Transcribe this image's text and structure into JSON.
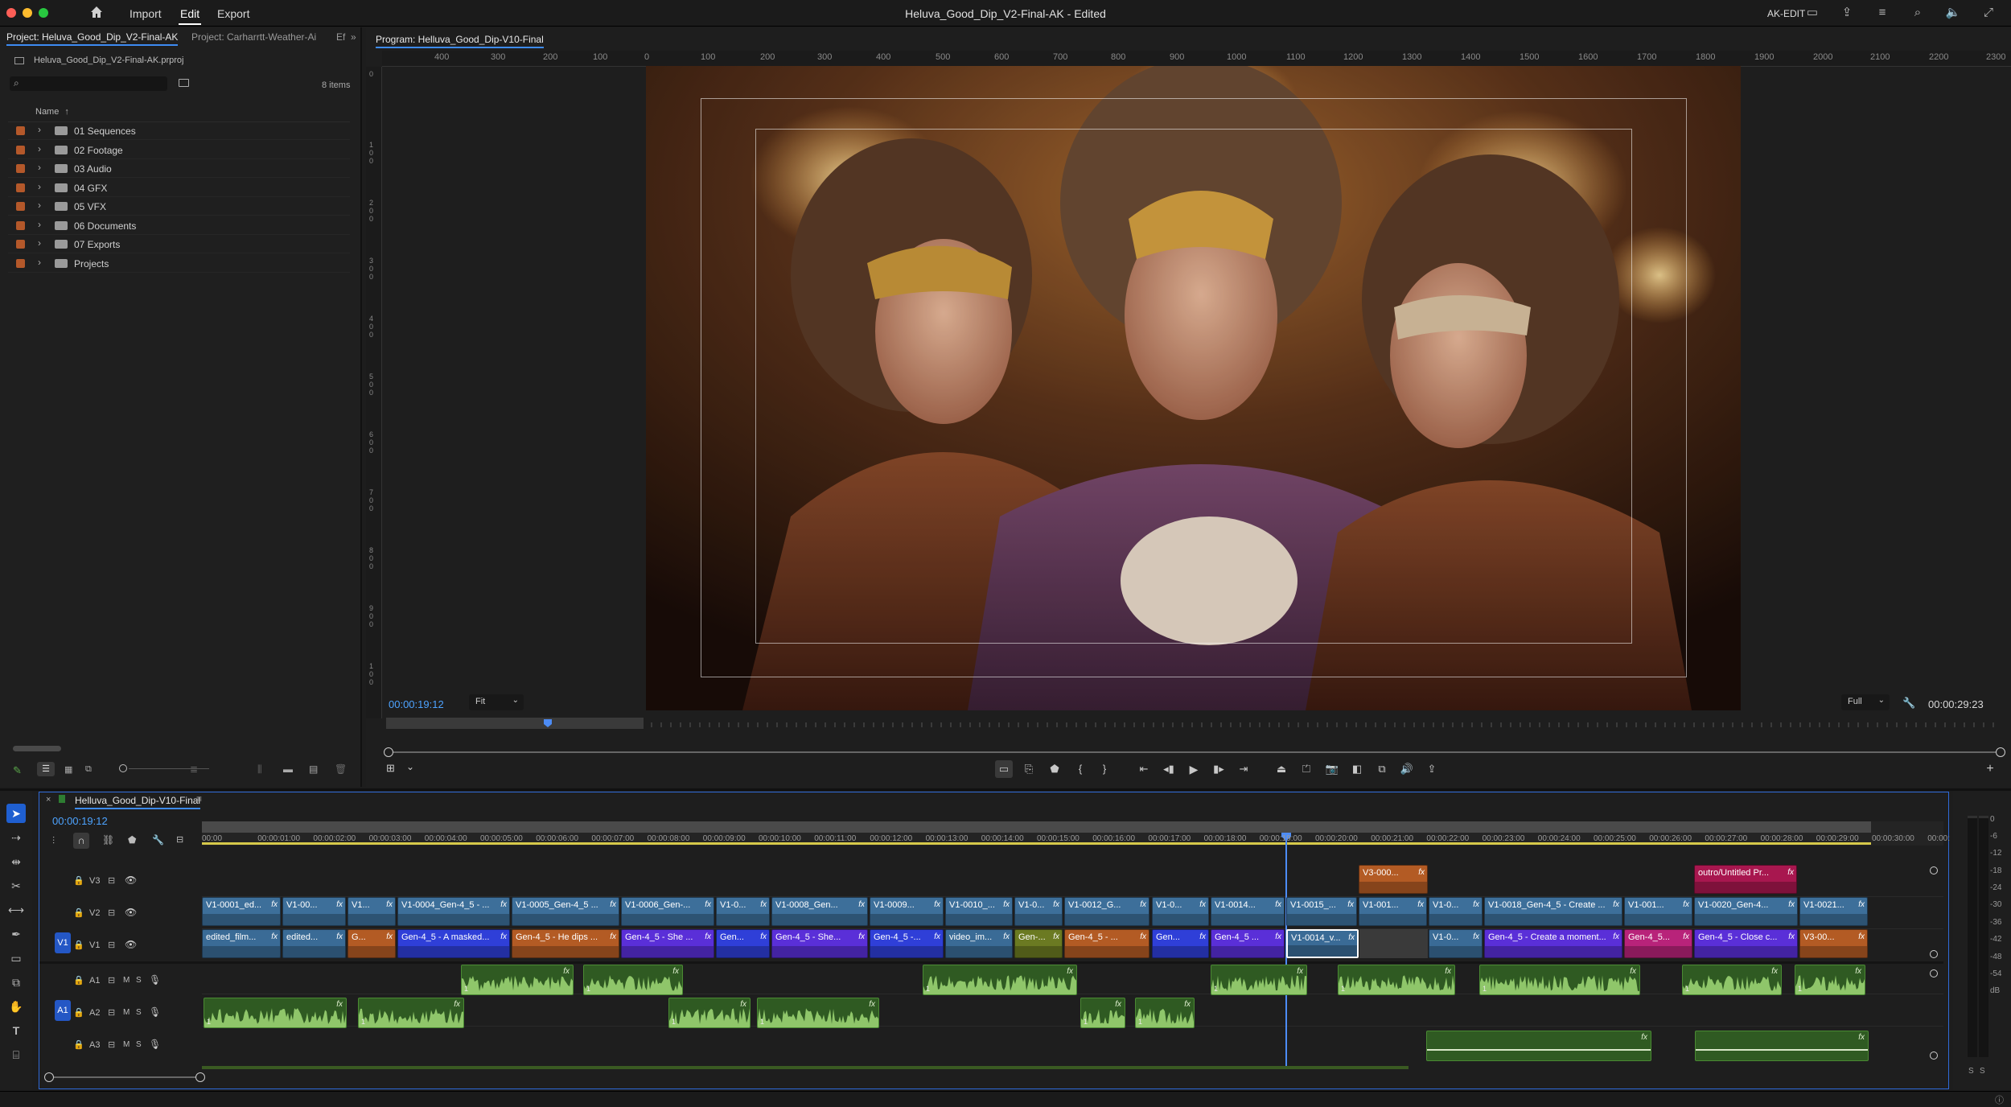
{
  "window": {
    "title": "Heluva_Good_Dip_V2-Final-AK - Edited",
    "workspace_user": "AK-EDIT"
  },
  "menu": {
    "import": "Import",
    "edit": "Edit",
    "export": "Export"
  },
  "project_panel": {
    "tab_active": "Project: Heluva_Good_Dip_V2-Final-AK",
    "tab_other": "Project: Carharrtt-Weather-Ai",
    "tab_effects": "Ef",
    "file_name": "Heluva_Good_Dip_V2-Final-AK.prproj",
    "item_count": "8 items",
    "column_name": "Name",
    "bins": [
      {
        "name": "01 Sequences"
      },
      {
        "name": "02 Footage"
      },
      {
        "name": "03 Audio"
      },
      {
        "name": "04 GFX"
      },
      {
        "name": "05 VFX"
      },
      {
        "name": "06 Documents"
      },
      {
        "name": "07 Exports"
      },
      {
        "name": "Projects"
      }
    ]
  },
  "program_monitor": {
    "tab": "Program: Helluva_Good_Dip-V10-Final",
    "ruler_labels": [
      "400",
      "300",
      "200",
      "100",
      "0",
      "100",
      "200",
      "300",
      "400",
      "500",
      "600",
      "700",
      "800",
      "900",
      "1000",
      "1100",
      "1200",
      "1300",
      "1400",
      "1500",
      "1600",
      "1700",
      "1800",
      "1900",
      "2000",
      "2100",
      "2200",
      "2300"
    ],
    "current_timecode": "00:00:19:12",
    "zoom": "Fit",
    "resolution": "Full",
    "duration": "00:00:29:23",
    "frame_description": "Three women in 18th-century ball gowns and masquerade masks with disgusted expressions in a candle-lit ballroom"
  },
  "timeline": {
    "sequence_name": "Helluva_Good_Dip-V10-Final",
    "playhead_timecode": "00:00:19:12",
    "ruler_labels": [
      "00:00",
      "00:00:01:00",
      "00:00:02:00",
      "00:00:03:00",
      "00:00:04:00",
      "00:00:05:00",
      "00:00:06:00",
      "00:00:07:00",
      "00:00:08:00",
      "00:00:09:00",
      "00:00:10:00",
      "00:00:11:00",
      "00:00:12:00",
      "00:00:13:00",
      "00:00:14:00",
      "00:00:15:00",
      "00:00:16:00",
      "00:00:17:00",
      "00:00:18:00",
      "00:00:19:00",
      "00:00:20:00",
      "00:00:21:00",
      "00:00:22:00",
      "00:00:23:00",
      "00:00:24:00",
      "00:00:25:00",
      "00:00:26:00",
      "00:00:27:00",
      "00:00:28:00",
      "00:00:29:00",
      "00:00:30:00",
      "00:00:"
    ],
    "tracks": {
      "v3": "V3",
      "v2": "V2",
      "v1": "V1",
      "a1": "A1",
      "a2": "A2",
      "a3": "A3",
      "src_v1": "V1",
      "src_a1": "A1",
      "m": "M",
      "s": "S"
    },
    "v3_clips": [
      {
        "label": "V3-000...",
        "color": "#b35b24"
      },
      {
        "label": "outro/Untitled Pr...",
        "color": "#a8174f"
      }
    ],
    "v2_clips": [
      {
        "label": "V1-0001_ed..."
      },
      {
        "label": "V1-00..."
      },
      {
        "label": "V1..."
      },
      {
        "label": "V1-0004_Gen-4_5 - ..."
      },
      {
        "label": "V1-0005_Gen-4_5 ..."
      },
      {
        "label": "V1-0006_Gen-..."
      },
      {
        "label": "V1-0..."
      },
      {
        "label": "V1-0008_Gen..."
      },
      {
        "label": "V1-0009..."
      },
      {
        "label": "V1-0010_..."
      },
      {
        "label": "V1-0..."
      },
      {
        "label": "V1-0012_G..."
      },
      {
        "label": "V1-0..."
      },
      {
        "label": "V1-0014..."
      },
      {
        "label": "V1-0015_..."
      },
      {
        "label": "V1-001..."
      },
      {
        "label": "V1-0..."
      },
      {
        "label": "V1-0018_Gen-4_5 - Create ..."
      },
      {
        "label": "V1-001..."
      },
      {
        "label": "V1-0020_Gen-4..."
      },
      {
        "label": "V1-0021..."
      }
    ],
    "v1_clips": [
      {
        "label": "edited_film...",
        "color": "#3a6b96"
      },
      {
        "label": "edited...",
        "color": "#3a6b96"
      },
      {
        "label": "G...",
        "color": "#b35b24"
      },
      {
        "label": "Gen-4_5 - A masked...",
        "color": "#2f3fd8"
      },
      {
        "label": "Gen-4_5 - He dips ...",
        "color": "#b35b24"
      },
      {
        "label": "Gen-4_5 - She ...",
        "color": "#5a2fd8"
      },
      {
        "label": "Gen...",
        "color": "#2f3fd8"
      },
      {
        "label": "Gen-4_5 - She...",
        "color": "#5a2fd8"
      },
      {
        "label": "Gen-4_5 -...",
        "color": "#2f3fd8"
      },
      {
        "label": "video_im...",
        "color": "#3a6b96"
      },
      {
        "label": "Gen-...",
        "color": "#6b7a22"
      },
      {
        "label": "Gen-4_5 - ...",
        "color": "#b35b24"
      },
      {
        "label": "Gen...",
        "color": "#2f3fd8"
      },
      {
        "label": "Gen-4_5 ...",
        "color": "#5a2fd8"
      },
      {
        "label": "V1-0014_v...",
        "color": "#3a6b96"
      },
      {
        "label": "V1-0...",
        "color": "#3a6b96"
      },
      {
        "label": "Gen-4_5 - Create a moment...",
        "color": "#5a2fd8"
      },
      {
        "label": "Gen-4_5...",
        "color": "#b8237a"
      },
      {
        "label": "Gen-4_5 - Close c...",
        "color": "#5a2fd8"
      },
      {
        "label": "V3-00...",
        "color": "#b35b24"
      }
    ],
    "fx": "fx",
    "audio_channel": "1",
    "meter_labels": [
      "0",
      "-6",
      "-12",
      "-18",
      "-24",
      "-30",
      "-36",
      "-42",
      "-48",
      "-54",
      "dB"
    ],
    "meter_solo": "S",
    "meter_solo2": "S"
  }
}
